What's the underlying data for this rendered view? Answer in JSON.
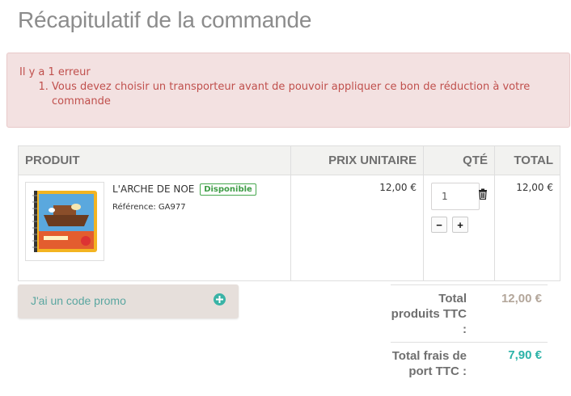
{
  "page": {
    "title": "Récapitulatif de la commande"
  },
  "alert": {
    "heading": "Il y a 1 erreur",
    "errors": [
      "Vous devez choisir un transporteur avant de pouvoir appliquer ce bon de réduction à votre commande"
    ]
  },
  "cart": {
    "headers": {
      "product": "PRODUIT",
      "unit_price": "PRIX UNITAIRE",
      "qty": "QTÉ",
      "total": "TOTAL"
    },
    "items": [
      {
        "name": "L'ARCHE DE NOE",
        "availability": "Disponible",
        "reference": "Référence: GA977",
        "unit_price": "12,00 €",
        "quantity": "1",
        "total": "12,00 €",
        "decrease_symbol": "−",
        "increase_symbol": "+"
      }
    ]
  },
  "promo": {
    "label": "J'ai un code promo"
  },
  "summary": {
    "products_label": "Total produits TTC :",
    "products_value": "12,00 €",
    "shipping_label": "Total frais de port TTC :",
    "shipping_value": "7,90 €"
  },
  "colors": {
    "alert_text": "#c0504d",
    "alert_bg": "#f3e1e1",
    "promo_teal": "#5aa6a0",
    "products_total": "#b3a69a",
    "shipping_total": "#2bb3a8",
    "available_badge": "#46a74e"
  }
}
